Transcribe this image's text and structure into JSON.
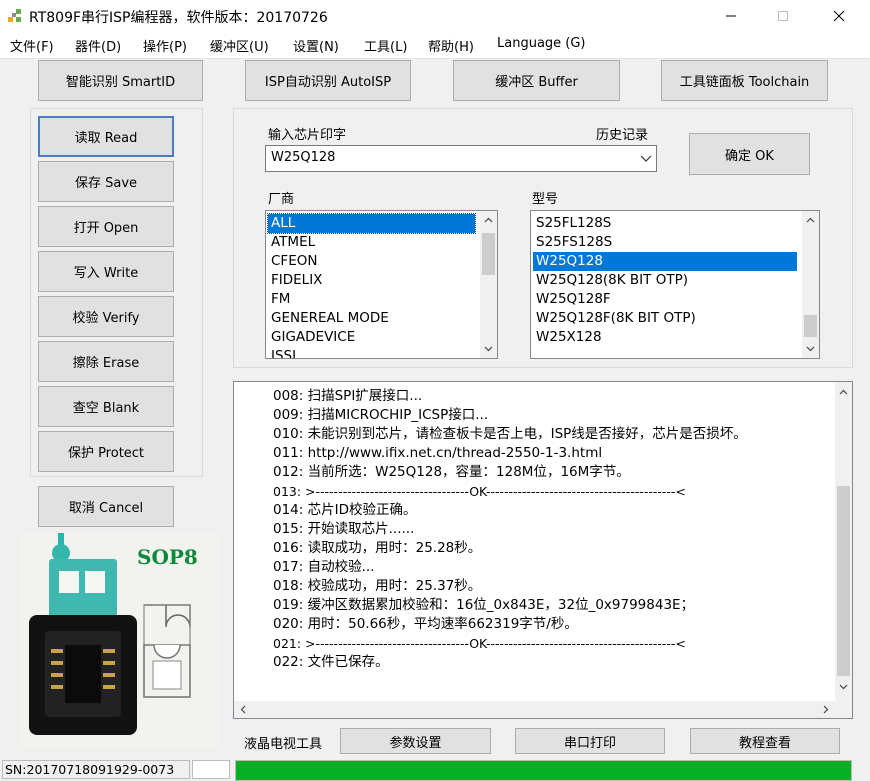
{
  "window": {
    "title": "RT809F串行ISP编程器，软件版本：20170726",
    "controls": [
      "minimize",
      "maximize",
      "close"
    ]
  },
  "menubar": [
    "文件(F)",
    "器件(D)",
    "操作(P)",
    "缓冲区(U)",
    "设置(N)",
    "工具(L)",
    "帮助(H)",
    "Language (G)"
  ],
  "top_buttons": {
    "smartid": "智能识别 SmartID",
    "autoisp": "ISP自动识别 AutoISP",
    "buffer": "缓冲区 Buffer",
    "toolchain": "工具链面板 Toolchain"
  },
  "ops": {
    "read": "读取 Read",
    "save": "保存 Save",
    "open": "打开 Open",
    "write": "写入 Write",
    "verify": "校验 Verify",
    "erase": "擦除 Erase",
    "blank": "查空 Blank",
    "protect": "保护 Protect",
    "cancel": "取消 Cancel"
  },
  "chip": {
    "input_label": "输入芯片印字",
    "history_label": "历史记录",
    "value": "W25Q128",
    "ok_button": "确定 OK"
  },
  "vendor": {
    "label": "厂商",
    "items": [
      "ALL",
      "ATMEL",
      "CFEON",
      "FIDELIX",
      "FM",
      "GENEREAL MODE",
      "GIGADEVICE",
      "ISSI"
    ],
    "selected": "ALL"
  },
  "model": {
    "label": "型号",
    "items": [
      "S25FL128S",
      "S25FS128S",
      "W25Q128",
      "W25Q128(8K BIT OTP)",
      "W25Q128F",
      "W25Q128F(8K BIT OTP)",
      "W25X128"
    ],
    "selected": "W25Q128"
  },
  "preview": {
    "package_label": "SOP8"
  },
  "log": [
    "008: 扫描SPI扩展接口...",
    "009: 扫描MICROCHIP_ICSP接口...",
    "010: 未能识别到芯片，请检查板卡是否上电，ISP线是否接好，芯片是否损坏。",
    "011: http://www.ifix.net.cn/thread-2550-1-3.html",
    "012: 当前所选：W25Q128，容量：128M位，16M字节。",
    "013: >----------------------------------OK------------------------------------------<",
    "014: 芯片ID校验正确。",
    "015: 开始读取芯片......",
    "016: 读取成功，用时：25.28秒。",
    "017: 自动校验...",
    "018: 校验成功，用时：25.37秒。",
    "019: 缓冲区数据累加校验和：16位_0x843E，32位_0x9799843E；",
    "020: 用时：50.66秒，平均速率662319字节/秒。",
    "021: >----------------------------------OK------------------------------------------<",
    "022: 文件已保存。"
  ],
  "bottom": {
    "label": "液晶电视工具",
    "params_button": "参数设置",
    "serial_button": "串口打印",
    "tutorial_button": "教程查看"
  },
  "status": {
    "serial": "SN:20170718091929-0073",
    "progress": 1.0
  },
  "colors": {
    "selection": "#0078d7",
    "progress": "#06b025"
  }
}
